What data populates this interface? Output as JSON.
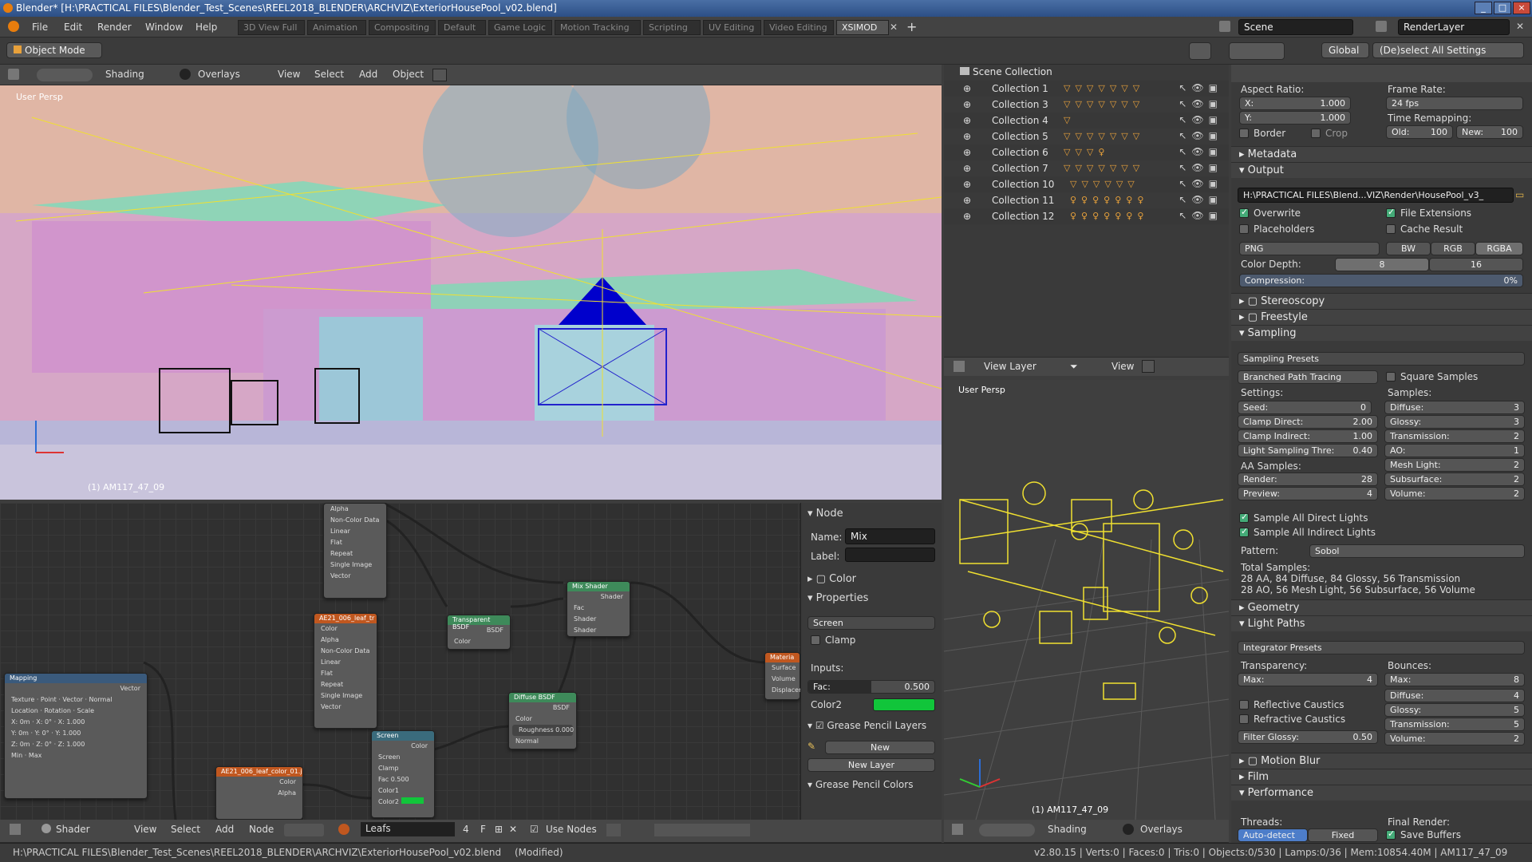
{
  "window": {
    "title": "Blender* [H:\\PRACTICAL FILES\\Blender_Test_Scenes\\REEL2018_BLENDER\\ARCHVIZ\\ExteriorHousePool_v02.blend]"
  },
  "menu": {
    "file": "File",
    "edit": "Edit",
    "render": "Render",
    "window": "Window",
    "help": "Help"
  },
  "workspaces": [
    "3D View Full",
    "Animation",
    "Compositing",
    "Default",
    "Game Logic",
    "Motion Tracking",
    "Scripting",
    "UV Editing",
    "Video Editing",
    "XSIMOD"
  ],
  "scene": {
    "name": "Scene",
    "render_layer": "RenderLayer"
  },
  "mode": "Object Mode",
  "header_right": {
    "orientation": "Global",
    "select_all": "(De)select All Settings"
  },
  "viewport": {
    "shading": "Shading",
    "overlays": "Overlays",
    "view": "View",
    "select": "Select",
    "add": "Add",
    "object": "Object",
    "label": "User Persp",
    "object_info": "(1) AM117_47_09"
  },
  "outliner": {
    "root": "Scene Collection",
    "collections": [
      "Collection 1",
      "Collection 3",
      "Collection 4",
      "Collection 5",
      "Collection 6",
      "Collection 7",
      "Collection 10",
      "Collection 11",
      "Collection 12"
    ],
    "footer_layer": "View Layer",
    "footer_view": "View"
  },
  "props": {
    "aspect_ratio": "Aspect Ratio:",
    "x_label": "X:",
    "x_val": "1.000",
    "y_label": "Y:",
    "y_val": "1.000",
    "frame_rate": "Frame Rate:",
    "fps": "24 fps",
    "time_remap": "Time Remapping:",
    "old_label": "Old:",
    "old": "100",
    "new_label": "New:",
    "new": "100",
    "border": "Border",
    "crop": "Crop",
    "metadata": "Metadata",
    "output": "Output",
    "output_path": "H:\\PRACTICAL FILES\\Blend...VIZ\\Render\\HousePool_v3_",
    "overwrite": "Overwrite",
    "file_ext": "File Extensions",
    "placeholders": "Placeholders",
    "cache_result": "Cache Result",
    "format": "PNG",
    "bw": "BW",
    "rgb": "RGB",
    "rgba": "RGBA",
    "color_depth": "Color Depth:",
    "depth8": "8",
    "depth16": "16",
    "compression": "Compression:",
    "compression_val": "0%",
    "stereoscopy": "Stereoscopy",
    "freestyle": "Freestyle",
    "sampling": "Sampling",
    "sampling_presets": "Sampling Presets",
    "integrator": "Branched Path Tracing",
    "square_samples": "Square Samples",
    "settings": "Settings:",
    "samples": "Samples:",
    "seed_label": "Seed:",
    "seed": "0",
    "clamp_direct_label": "Clamp Direct:",
    "clamp_direct": "2.00",
    "clamp_indirect_label": "Clamp Indirect:",
    "clamp_indirect": "1.00",
    "light_thre_label": "Light Sampling Thre:",
    "light_thre": "0.40",
    "diffuse_label": "Diffuse:",
    "diffuse": "3",
    "glossy_label": "Glossy:",
    "glossy": "3",
    "transmission_label": "Transmission:",
    "transmission": "2",
    "ao_label": "AO:",
    "ao": "1",
    "mesh_light_label": "Mesh Light:",
    "mesh_light": "2",
    "subsurface_label": "Subsurface:",
    "subsurface": "2",
    "volume_label": "Volume:",
    "volume": "2",
    "aa_samples": "AA Samples:",
    "render_label": "Render:",
    "render_val": "28",
    "preview_label": "Preview:",
    "preview_val": "4",
    "sample_direct": "Sample All Direct Lights",
    "sample_indirect": "Sample All Indirect Lights",
    "pattern_label": "Pattern:",
    "pattern": "Sobol",
    "total_samples": "Total Samples:",
    "total_line1": "28 AA, 84 Diffuse, 84 Glossy, 56 Transmission",
    "total_line2": "28 AO, 56 Mesh Light, 56 Subsurface, 56 Volume",
    "geometry": "Geometry",
    "light_paths": "Light Paths",
    "integrator_presets": "Integrator Presets",
    "transparency": "Transparency:",
    "bounces": "Bounces:",
    "max_label": "Max:",
    "t_max": "4",
    "b_max": "8",
    "b_diffuse": "4",
    "b_glossy": "5",
    "b_transmission": "5",
    "b_volume": "2",
    "reflective": "Reflective Caustics",
    "refractive": "Refractive Caustics",
    "filter_glossy_label": "Filter Glossy:",
    "filter_glossy": "0.50",
    "motion_blur": "Motion Blur",
    "film": "Film",
    "performance": "Performance",
    "threads": "Threads:",
    "final_render": "Final Render:",
    "auto_detect": "Auto-detect",
    "fixed": "Fixed",
    "save_buffers": "Save Buffers"
  },
  "node_panel": {
    "node": "Node",
    "name_label": "Name:",
    "name_val": "Mix",
    "label_label": "Label:",
    "color": "Color",
    "properties": "Properties",
    "blend": "Screen",
    "clamp": "Clamp",
    "inputs": "Inputs:",
    "fac_label": "Fac:",
    "fac_val": "0.500",
    "fac_fraction": 0.5,
    "color2": "Color2",
    "gp_layers": "Grease Pencil Layers",
    "new": "New",
    "new_layer": "New Layer",
    "gp_colors": "Grease Pencil Colors"
  },
  "node_footer": {
    "type": "Shader",
    "view": "View",
    "select": "Select",
    "add": "Add",
    "node": "Node",
    "material": "Leafs",
    "users": "4",
    "f": "F",
    "use_nodes": "Use Nodes"
  },
  "nodes": {
    "mix": "Mix Shader",
    "transparent": "Transparent BSDF",
    "diffuse": "Diffuse BSDF",
    "screen": "Screen",
    "mapping": "Mapping",
    "img1": "AE21_006_leaf_tr",
    "img2": "AE21_006_leaf_color_01.j",
    "output": "Materia",
    "roughness": "Roughness 0.000"
  },
  "viewport2": {
    "label": "User Persp",
    "object_info": "(1) AM117_47_09",
    "shading": "Shading",
    "overlays": "Overlays"
  },
  "status": {
    "path": "H:\\PRACTICAL FILES\\Blender_Test_Scenes\\REEL2018_BLENDER\\ARCHVIZ\\ExteriorHousePool_v02.blend",
    "modified": "(Modified)",
    "stats": "v2.80.15 | Verts:0 | Faces:0 | Tris:0 | Objects:0/530 | Lamps:0/36 | Mem:10854.40M | AM117_47_09"
  },
  "colors": {
    "accent": "#e87d0d",
    "selected": "#4d7dc9",
    "fac_color2": "#11c53a",
    "wire": "#f0e030"
  }
}
